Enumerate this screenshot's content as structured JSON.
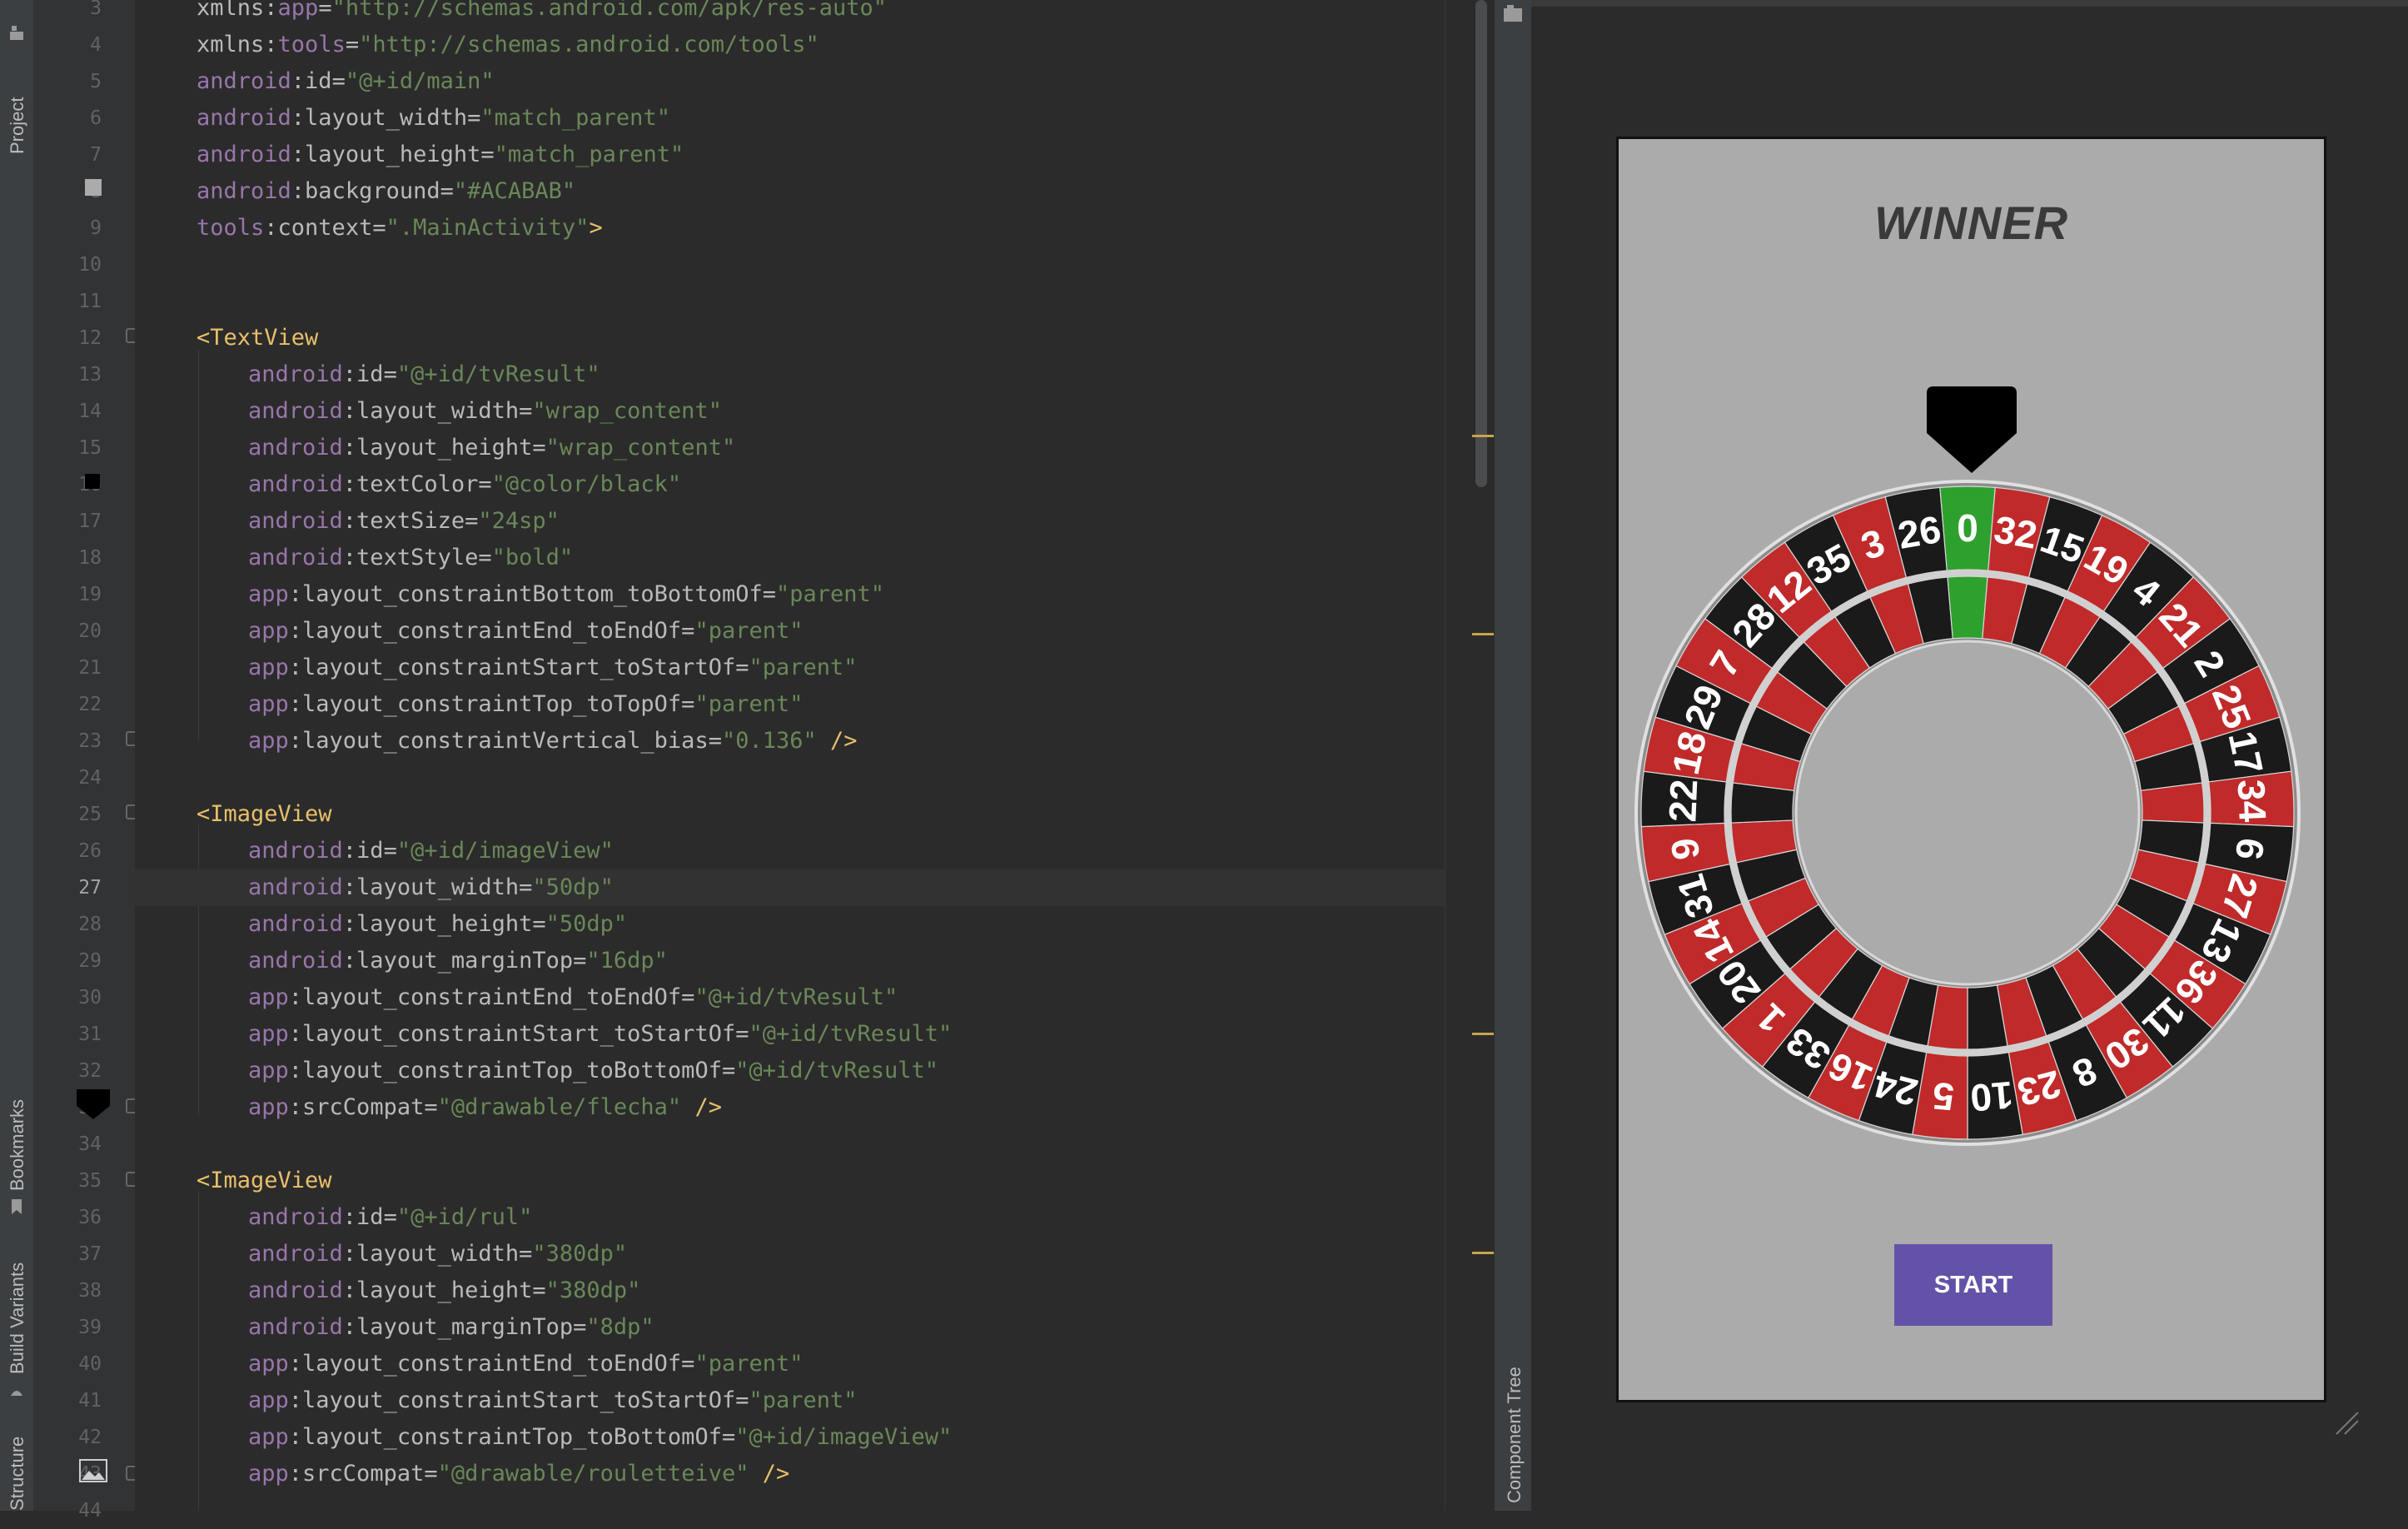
{
  "tool_windows": {
    "left": [
      "Project",
      "Bookmarks",
      "Build Variants",
      "Structure"
    ],
    "right": [
      "Component Tree"
    ]
  },
  "editor": {
    "current_line": "27",
    "lines": [
      {
        "n": "3",
        "segs": [
          [
            "attr",
            "xmlns:"
          ],
          [
            "ns",
            "app"
          ],
          [
            "attr",
            "="
          ],
          [
            "val",
            "\"http://schemas.android.com/apk/res-auto\""
          ]
        ],
        "indent": 0
      },
      {
        "n": "4",
        "segs": [
          [
            "attr",
            "xmlns:"
          ],
          [
            "ns",
            "tools"
          ],
          [
            "attr",
            "="
          ],
          [
            "val",
            "\"http://schemas.android.com/tools\""
          ]
        ],
        "indent": 0
      },
      {
        "n": "5",
        "segs": [
          [
            "ns",
            "android"
          ],
          [
            "attr",
            ":id="
          ],
          [
            "val",
            "\"@+id/main\""
          ]
        ],
        "indent": 0
      },
      {
        "n": "6",
        "segs": [
          [
            "ns",
            "android"
          ],
          [
            "attr",
            ":layout_width="
          ],
          [
            "val",
            "\"match_parent\""
          ]
        ],
        "indent": 0
      },
      {
        "n": "7",
        "segs": [
          [
            "ns",
            "android"
          ],
          [
            "attr",
            ":layout_height="
          ],
          [
            "val",
            "\"match_parent\""
          ]
        ],
        "indent": 0
      },
      {
        "n": "8",
        "segs": [
          [
            "ns",
            "android"
          ],
          [
            "attr",
            ":background="
          ],
          [
            "val",
            "\"#ACABAB\""
          ]
        ],
        "indent": 0
      },
      {
        "n": "9",
        "segs": [
          [
            "ns",
            "tools"
          ],
          [
            "attr",
            ":context="
          ],
          [
            "val",
            "\".MainActivity\""
          ],
          [
            "punct",
            ">"
          ]
        ],
        "indent": 0
      },
      {
        "n": "10",
        "segs": [],
        "indent": 0
      },
      {
        "n": "11",
        "segs": [],
        "indent": 0
      },
      {
        "n": "12",
        "segs": [
          [
            "punct",
            "<"
          ],
          [
            "tag",
            "TextView"
          ]
        ],
        "indent": 0
      },
      {
        "n": "13",
        "segs": [
          [
            "ns",
            "android"
          ],
          [
            "attr",
            ":id="
          ],
          [
            "val",
            "\"@+id/tvResult\""
          ]
        ],
        "indent": 1
      },
      {
        "n": "14",
        "segs": [
          [
            "ns",
            "android"
          ],
          [
            "attr",
            ":layout_width="
          ],
          [
            "val",
            "\"wrap_content\""
          ]
        ],
        "indent": 1
      },
      {
        "n": "15",
        "segs": [
          [
            "ns",
            "android"
          ],
          [
            "attr",
            ":layout_height="
          ],
          [
            "val",
            "\"wrap_content\""
          ]
        ],
        "indent": 1
      },
      {
        "n": "16",
        "segs": [
          [
            "ns",
            "android"
          ],
          [
            "attr",
            ":textColor="
          ],
          [
            "val",
            "\"@color/black\""
          ]
        ],
        "indent": 1
      },
      {
        "n": "17",
        "segs": [
          [
            "ns",
            "android"
          ],
          [
            "attr",
            ":textSize="
          ],
          [
            "val",
            "\"24sp\""
          ]
        ],
        "indent": 1
      },
      {
        "n": "18",
        "segs": [
          [
            "ns",
            "android"
          ],
          [
            "attr",
            ":textStyle="
          ],
          [
            "val",
            "\"bold\""
          ]
        ],
        "indent": 1
      },
      {
        "n": "19",
        "segs": [
          [
            "ns",
            "app"
          ],
          [
            "attr",
            ":layout_constraintBottom_toBottomOf="
          ],
          [
            "val",
            "\"parent\""
          ]
        ],
        "indent": 1
      },
      {
        "n": "20",
        "segs": [
          [
            "ns",
            "app"
          ],
          [
            "attr",
            ":layout_constraintEnd_toEndOf="
          ],
          [
            "val",
            "\"parent\""
          ]
        ],
        "indent": 1
      },
      {
        "n": "21",
        "segs": [
          [
            "ns",
            "app"
          ],
          [
            "attr",
            ":layout_constraintStart_toStartOf="
          ],
          [
            "val",
            "\"parent\""
          ]
        ],
        "indent": 1
      },
      {
        "n": "22",
        "segs": [
          [
            "ns",
            "app"
          ],
          [
            "attr",
            ":layout_constraintTop_toTopOf="
          ],
          [
            "val",
            "\"parent\""
          ]
        ],
        "indent": 1
      },
      {
        "n": "23",
        "segs": [
          [
            "ns",
            "app"
          ],
          [
            "attr",
            ":layout_constraintVertical_bias="
          ],
          [
            "val",
            "\"0.136\""
          ],
          [
            "punct",
            " />"
          ]
        ],
        "indent": 1
      },
      {
        "n": "24",
        "segs": [],
        "indent": 0
      },
      {
        "n": "25",
        "segs": [
          [
            "punct",
            "<"
          ],
          [
            "tag",
            "ImageView"
          ]
        ],
        "indent": 0
      },
      {
        "n": "26",
        "segs": [
          [
            "ns",
            "android"
          ],
          [
            "attr",
            ":id="
          ],
          [
            "val",
            "\"@+id/imageView\""
          ]
        ],
        "indent": 1
      },
      {
        "n": "27",
        "segs": [
          [
            "ns",
            "android"
          ],
          [
            "attr",
            ":layout_width="
          ],
          [
            "val",
            "\"50dp\""
          ]
        ],
        "indent": 1
      },
      {
        "n": "28",
        "segs": [
          [
            "ns",
            "android"
          ],
          [
            "attr",
            ":layout_height="
          ],
          [
            "val",
            "\"50dp\""
          ]
        ],
        "indent": 1
      },
      {
        "n": "29",
        "segs": [
          [
            "ns",
            "android"
          ],
          [
            "attr",
            ":layout_marginTop="
          ],
          [
            "val",
            "\"16dp\""
          ]
        ],
        "indent": 1
      },
      {
        "n": "30",
        "segs": [
          [
            "ns",
            "app"
          ],
          [
            "attr",
            ":layout_constraintEnd_toEndOf="
          ],
          [
            "val",
            "\"@+id/tvResult\""
          ]
        ],
        "indent": 1
      },
      {
        "n": "31",
        "segs": [
          [
            "ns",
            "app"
          ],
          [
            "attr",
            ":layout_constraintStart_toStartOf="
          ],
          [
            "val",
            "\"@+id/tvResult\""
          ]
        ],
        "indent": 1
      },
      {
        "n": "32",
        "segs": [
          [
            "ns",
            "app"
          ],
          [
            "attr",
            ":layout_constraintTop_toBottomOf="
          ],
          [
            "val",
            "\"@+id/tvResult\""
          ]
        ],
        "indent": 1
      },
      {
        "n": "33",
        "segs": [
          [
            "ns",
            "app"
          ],
          [
            "attr",
            ":srcCompat="
          ],
          [
            "val",
            "\"@drawable/flecha\""
          ],
          [
            "punct",
            " />"
          ]
        ],
        "indent": 1
      },
      {
        "n": "34",
        "segs": [],
        "indent": 0
      },
      {
        "n": "35",
        "segs": [
          [
            "punct",
            "<"
          ],
          [
            "tag",
            "ImageView"
          ]
        ],
        "indent": 0
      },
      {
        "n": "36",
        "segs": [
          [
            "ns",
            "android"
          ],
          [
            "attr",
            ":id="
          ],
          [
            "val",
            "\"@+id/rul\""
          ]
        ],
        "indent": 1
      },
      {
        "n": "37",
        "segs": [
          [
            "ns",
            "android"
          ],
          [
            "attr",
            ":layout_width="
          ],
          [
            "val",
            "\"380dp\""
          ]
        ],
        "indent": 1
      },
      {
        "n": "38",
        "segs": [
          [
            "ns",
            "android"
          ],
          [
            "attr",
            ":layout_height="
          ],
          [
            "val",
            "\"380dp\""
          ]
        ],
        "indent": 1
      },
      {
        "n": "39",
        "segs": [
          [
            "ns",
            "android"
          ],
          [
            "attr",
            ":layout_marginTop="
          ],
          [
            "val",
            "\"8dp\""
          ]
        ],
        "indent": 1
      },
      {
        "n": "40",
        "segs": [
          [
            "ns",
            "app"
          ],
          [
            "attr",
            ":layout_constraintEnd_toEndOf="
          ],
          [
            "val",
            "\"parent\""
          ]
        ],
        "indent": 1
      },
      {
        "n": "41",
        "segs": [
          [
            "ns",
            "app"
          ],
          [
            "attr",
            ":layout_constraintStart_toStartOf="
          ],
          [
            "val",
            "\"parent\""
          ]
        ],
        "indent": 1
      },
      {
        "n": "42",
        "segs": [
          [
            "ns",
            "app"
          ],
          [
            "attr",
            ":layout_constraintTop_toBottomOf="
          ],
          [
            "val",
            "\"@+id/imageView\""
          ]
        ],
        "indent": 1
      },
      {
        "n": "43",
        "segs": [
          [
            "ns",
            "app"
          ],
          [
            "attr",
            ":srcCompat="
          ],
          [
            "val",
            "\"@drawable/rouletteive\""
          ],
          [
            "punct",
            " />"
          ]
        ],
        "indent": 1
      },
      {
        "n": "44",
        "segs": [],
        "indent": 0
      }
    ]
  },
  "preview": {
    "result_text": "WINNER",
    "start_label": "START",
    "wheel_numbers": [
      "0",
      "32",
      "15",
      "19",
      "4",
      "21",
      "2",
      "25",
      "17",
      "34",
      "6",
      "27",
      "13",
      "36",
      "11",
      "30",
      "8",
      "23",
      "10",
      "5",
      "24",
      "16",
      "33",
      "1",
      "20",
      "14",
      "31",
      "9",
      "22",
      "18",
      "29",
      "7",
      "28",
      "12",
      "35",
      "3",
      "26"
    ],
    "colors": {
      "background": "#ACABAB",
      "button": "#6352A8",
      "red": "#c02a2a",
      "black": "#1a1a1a",
      "green": "#2ea02e"
    }
  }
}
